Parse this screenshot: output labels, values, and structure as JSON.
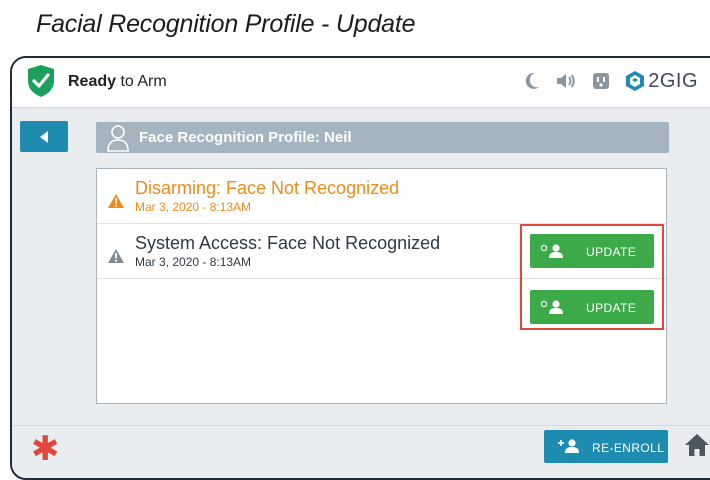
{
  "caption": "Facial Recognition Profile - Update",
  "statusbar": {
    "ready_bold": "Ready",
    "ready_rest": " to Arm",
    "brand": "2GIG",
    "icons": [
      "shield-check-icon",
      "moon-icon",
      "speaker-icon",
      "outlet-icon",
      "brand-logo-icon"
    ]
  },
  "header": {
    "title": "Face Recognition Profile: ",
    "name": "Neil"
  },
  "events": [
    {
      "title": "Disarming: Face Not Recognized",
      "date": "Mar 3, 2020 - 8:13AM",
      "status": "alert",
      "button": "UPDATE"
    },
    {
      "title": "System Access: Face Not Recognized",
      "date": "Mar 3, 2020 - 8:13AM",
      "status": "neutral",
      "button": "UPDATE"
    }
  ],
  "footer": {
    "reenroll_label": "RE-ENROLL"
  },
  "colors": {
    "accent_blue": "#1e8bb0",
    "update_green": "#3daa49",
    "alert_orange": "#f28a1a",
    "highlight_red": "#e2473a"
  }
}
